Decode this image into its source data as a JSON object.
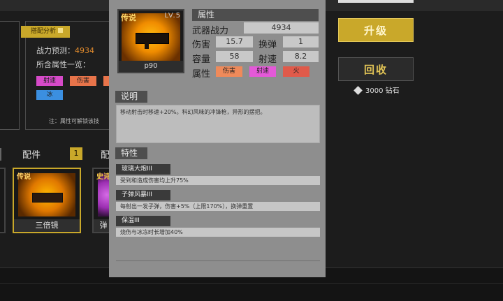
{
  "background": {
    "analysis": {
      "tag": "搭配分析",
      "predict_label": "战力预测：",
      "predict_value": "4934",
      "contains_label": "所含属性一览：",
      "tags": [
        {
          "label": "射速",
          "color": "#d64ac8"
        },
        {
          "label": "伤害",
          "color": "#e8744a"
        },
        {
          "label": "冰",
          "color": "#3b8fe0"
        }
      ],
      "note": "注：属性可解锁该技"
    },
    "section": {
      "label": "配件",
      "count": "1",
      "label2": "配"
    },
    "cards": [
      {
        "rarity": "传说",
        "name": "三倍镜"
      },
      {
        "rarity": "史诗",
        "name": "弹"
      }
    ],
    "buttons": {
      "upgrade": "升级",
      "recycle": "回收",
      "cost_value": "3000",
      "cost_unit": "钻石"
    }
  },
  "item": {
    "rarity": "传说",
    "level": "LV.5",
    "name": "p90",
    "attributes_header": "属性",
    "power_label": "武器战力",
    "power_value": "4934",
    "damage_label": "伤害",
    "damage_value": "15.7",
    "reload_label": "换弹",
    "reload_value": "1",
    "capacity_label": "容量",
    "capacity_value": "58",
    "firerate_label": "射速",
    "firerate_value": "8.2",
    "props_label": "属性",
    "props": [
      {
        "label": "伤害",
        "color": "#ef8a5a"
      },
      {
        "label": "射速",
        "color": "#e459d8"
      },
      {
        "label": "火",
        "color": "#e05a4a"
      }
    ],
    "desc_header": "说明",
    "description": "移动射击时移速+20%。科幻风味的冲锋枪，异形的摆把。",
    "traits_header": "特性",
    "traits": [
      {
        "name": "玻璃大炮III",
        "desc": "受到和造成伤害均上升75%"
      },
      {
        "name": "子弹风暴III",
        "desc": "每射出一发子弹，伤害+5%（上限170%），换弹重置"
      },
      {
        "name": "保温III",
        "desc": "烧伤与冰冻时长增加40%"
      }
    ]
  }
}
